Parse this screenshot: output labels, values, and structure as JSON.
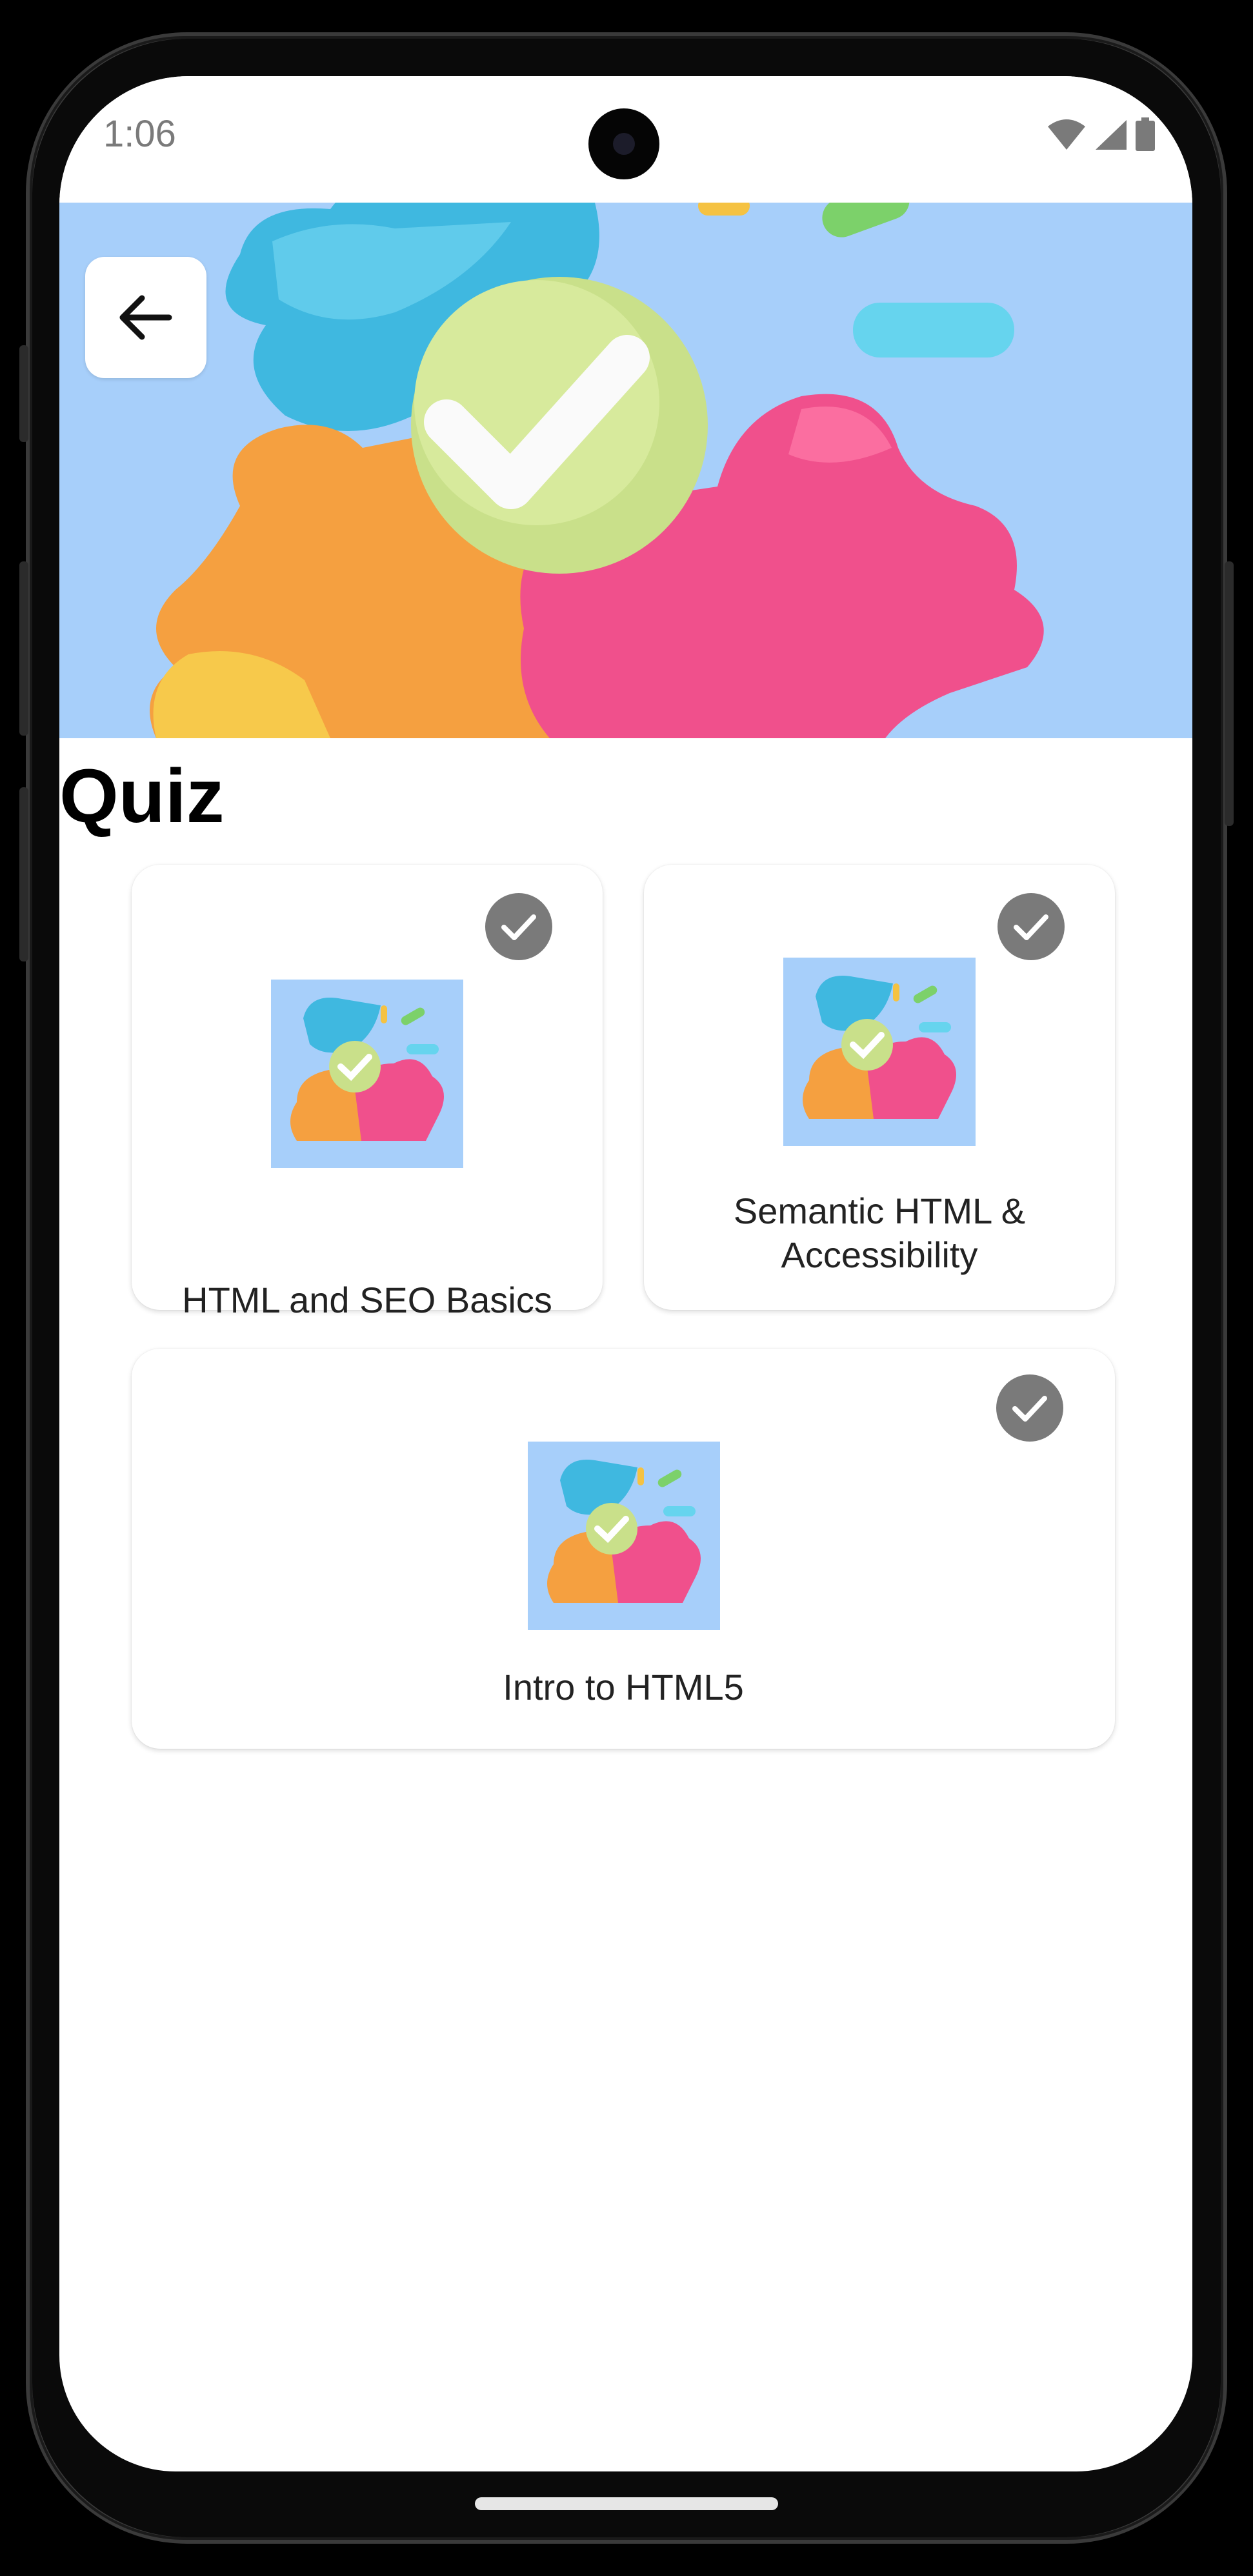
{
  "status_bar": {
    "time": "1:06",
    "icons": [
      "wifi-icon",
      "signal-icon",
      "battery-icon"
    ]
  },
  "header": {
    "back_icon": "arrow-left-icon"
  },
  "page": {
    "title": "Quiz"
  },
  "quizzes": [
    {
      "label": "HTML and SEO Basics",
      "completed": true
    },
    {
      "label_line1": "Semantic HTML &",
      "label_line2": "Accessibility",
      "completed": true
    },
    {
      "label": "Intro to HTML5",
      "completed": true
    }
  ],
  "colors": {
    "hero_bg": "#a7cffa",
    "check_badge": "#7a7a7a",
    "accent_green": "#c9e08a",
    "accent_pink": "#f0508c",
    "accent_orange": "#f5a040",
    "accent_cyan": "#4cc6e8"
  }
}
